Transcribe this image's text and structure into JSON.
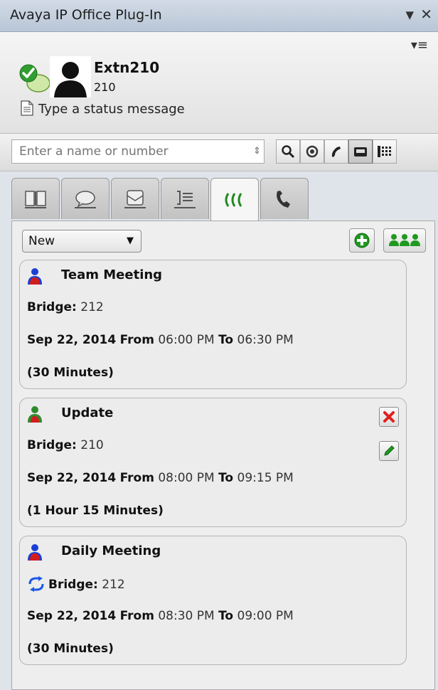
{
  "window": {
    "title": "Avaya IP Office Plug-In",
    "collapse_glyph": "▼",
    "close_glyph": "✕"
  },
  "profile": {
    "menu_icon": "menu-icon",
    "name": "Extn210",
    "number": "210",
    "status_message_placeholder": "Type a status message",
    "presence_icon": "available-presence-icon"
  },
  "search": {
    "placeholder": "Enter a name or number",
    "buttons": [
      "search-icon",
      "voicemail-icon",
      "call-icon",
      "desk-phone-icon",
      "dialpad-icon"
    ]
  },
  "tabs": [
    {
      "name": "directory",
      "icon": "directory-book-icon"
    },
    {
      "name": "messaging",
      "icon": "chat-bubble-icon"
    },
    {
      "name": "voicemail",
      "icon": "voicemail-tab-icon"
    },
    {
      "name": "call-log",
      "icon": "call-log-icon"
    },
    {
      "name": "conference",
      "icon": "conference-icon",
      "active": true
    },
    {
      "name": "calls",
      "icon": "phone-handset-icon"
    }
  ],
  "conference": {
    "filter_value": "New",
    "add_button": "add-conference-icon",
    "group_button": "group-conference-icon",
    "meetings": [
      {
        "title": "Team Meeting",
        "bridge_label": "Bridge:",
        "bridge": "212",
        "date": "Sep 22, 2014",
        "from_label": "From",
        "from": "06:00 PM",
        "to_label": "To",
        "to": "06:30 PM",
        "duration": "(30 Minutes)",
        "owner_color": "#d21d1d",
        "recurring": false,
        "editable": false
      },
      {
        "title": "Update",
        "bridge_label": "Bridge:",
        "bridge": "210",
        "date": "Sep 22, 2014",
        "from_label": "From",
        "from": "08:00 PM",
        "to_label": "To",
        "to": "09:15 PM",
        "duration": "(1 Hour 15 Minutes)",
        "owner_color": "#2e8b2e",
        "recurring": false,
        "editable": true
      },
      {
        "title": "Daily Meeting",
        "bridge_label": "Bridge:",
        "bridge": "212",
        "date": "Sep 22, 2014",
        "from_label": "From",
        "from": "08:30 PM",
        "to_label": "To",
        "to": "09:00 PM",
        "duration": "(30 Minutes)",
        "owner_color": "#d21d1d",
        "recurring": true,
        "editable": false
      }
    ]
  },
  "colors": {
    "accent_green": "#1f9a1f",
    "delete_red": "#e02020",
    "person_blue": "#1b3fd6",
    "recur_blue": "#1a57e8"
  }
}
